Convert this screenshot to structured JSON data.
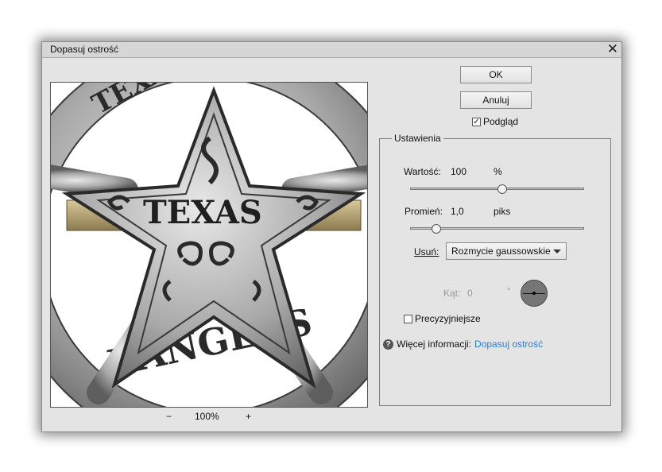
{
  "dialog": {
    "title": "Dopasuj ostrość",
    "close_glyph": "✕"
  },
  "buttons": {
    "ok": "OK",
    "cancel": "Anuluj"
  },
  "preview_toggle": {
    "label": "Podgląd",
    "checked": true
  },
  "preview_image": {
    "badge_text": "TEXAS",
    "ring_top": "TEXAS",
    "ring_bottom": "RANGERS"
  },
  "zoom": {
    "minus": "−",
    "value": "100%",
    "plus": "+"
  },
  "settings": {
    "group_label": "Ustawienia",
    "amount": {
      "label": "Wartość:",
      "value": "100",
      "unit": "%",
      "slider_fraction": 0.53
    },
    "radius": {
      "label": "Promień:",
      "value": "1,0",
      "unit": "piks",
      "slider_fraction": 0.15
    },
    "remove": {
      "label": "Usuń:",
      "selected": "Rozmycie gaussowskie"
    },
    "angle": {
      "label": "Kąt:",
      "value": "0",
      "unit": "°"
    },
    "more_accurate": {
      "label": "Precyzyjniejsze",
      "checked": false
    },
    "more_info": {
      "label": "Więcej informacji:",
      "link": "Dopasuj ostrość"
    }
  },
  "icons": {
    "close": "close-icon",
    "help": "help-icon",
    "dropdown": "chevron-down-icon",
    "angle_dial": "angle-dial-icon"
  }
}
